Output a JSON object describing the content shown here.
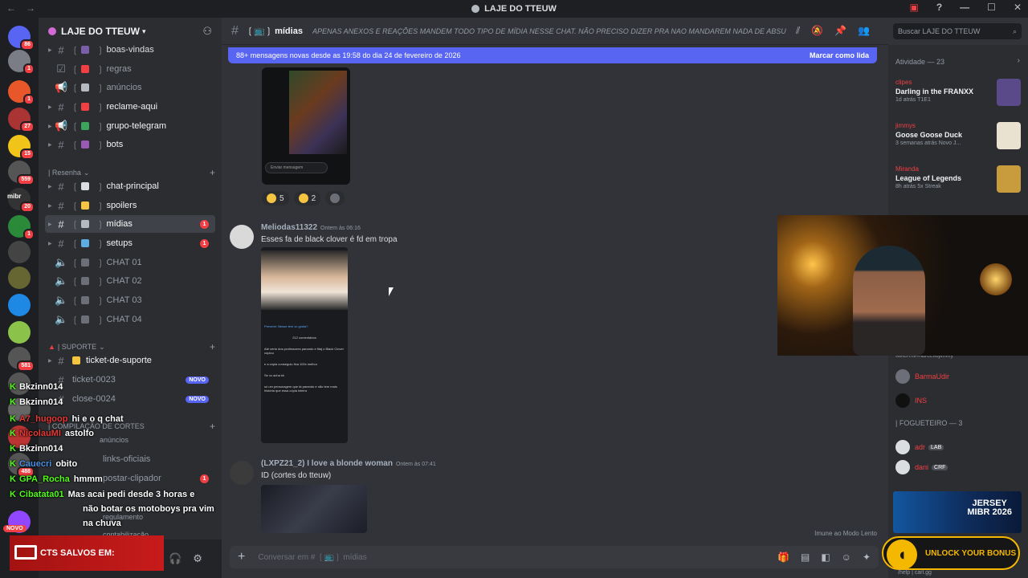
{
  "window": {
    "title": "LAJE DO TTEUW"
  },
  "guild": {
    "name": "LAJE DO TTEUW"
  },
  "servers": [
    {
      "badge": "86",
      "color": "#5865f2"
    },
    {
      "badge": "1",
      "color": "#7a7d85"
    },
    {
      "badge": "1",
      "color": "#e8572a"
    },
    {
      "badge": "27",
      "color": "#a33"
    },
    {
      "badge": "15",
      "color": "#f0c419"
    },
    {
      "badge": "559",
      "color": "#555"
    },
    {
      "badge": "20",
      "color": "#333"
    },
    {
      "badge": "1",
      "color": "#2a8a3a"
    },
    {
      "badge": "",
      "color": "#444"
    },
    {
      "badge": "",
      "color": "#663"
    },
    {
      "badge": "",
      "color": "#1e88e5"
    },
    {
      "badge": "",
      "color": "#8bc34a"
    },
    {
      "badge": "581",
      "color": "#555"
    },
    {
      "badge": "",
      "color": "#555"
    },
    {
      "badge": "",
      "color": "#666"
    },
    {
      "badge": "",
      "color": "#b33"
    },
    {
      "badge": "488",
      "color": "#555"
    },
    {
      "badge": "",
      "color": "#9146ff"
    }
  ],
  "rail_labels": {
    "mibr": "mibr",
    "novo": "NOVO"
  },
  "channels": {
    "boas_vindas": "boas-vindas",
    "regras": "regras",
    "anuncios": "anúncios",
    "reclame_aqui": "reclame-aqui",
    "grupo_telegram": "grupo-telegram",
    "bots": "bots",
    "cat_resenha": "| Resenha",
    "chat_principal": "chat-principal",
    "spoilers": "spoilers",
    "midias": "mídias",
    "midias_badge": "1",
    "setups": "setups",
    "setups_badge": "1",
    "chat01": "CHAT 01",
    "chat02": "CHAT 02",
    "chat03": "CHAT 03",
    "chat04": "CHAT 04",
    "cat_suporte": "| SUPORTE",
    "ticket_suporte": "ticket-de-suporte",
    "ticket_0023": "ticket-0023",
    "ticket_0024": "close-0024",
    "novo": "NOVO",
    "cat_cortes": "| COMPILAÇÃO DE CORTES",
    "cortes_anuncios": "anúncios",
    "links_oficiais": "links-oficiais",
    "postagem": "postar-clipador",
    "regulamento": "regulamento",
    "contabilizacao": "contabilização"
  },
  "overlay_chat": [
    {
      "name": "Bkzinn014",
      "color": "",
      "msg": ""
    },
    {
      "name": "Bkzinn014",
      "color": "",
      "msg": ""
    },
    {
      "name": "A7_hugoop",
      "color": "red",
      "msg": "hi e o q chat"
    },
    {
      "name": "NicolauMI",
      "color": "red",
      "msg": "astolfo"
    },
    {
      "name": "Bkzinn014",
      "color": "",
      "msg": ""
    },
    {
      "name": "Cauecri",
      "color": "blue",
      "msg": "obito"
    },
    {
      "name": "GPA_Rocha",
      "color": "green",
      "msg": "hmmm"
    },
    {
      "name": "Cibatata01",
      "color": "green",
      "msg": "Mas acai pedi desde 3 horas e"
    },
    {
      "name": "",
      "color": "",
      "msg": "não botar os motoboys pra vim"
    },
    {
      "name": "",
      "color": "",
      "msg": "na chuva"
    }
  ],
  "user_banner": "CTS SALVOS EM:",
  "header": {
    "channel": "mídias",
    "topic": "APENAS ANEXOS E REAÇÕES MANDEM TODO TIPO DE MÍDIA NESSE CHAT. NÃO PRECISO DIZER PRA NAO MANDAREM NADA DE ABSURDO NÉ? ...",
    "search_placeholder": "Buscar LAJE DO TTEUW"
  },
  "newbar": {
    "text": "88+ mensagens novas desde as 19:58 do dia 24 de fevereiro de 2026",
    "action": "Marcar como lida"
  },
  "messages": {
    "img_input": "Enviar mensagem",
    "reactions": [
      {
        "count": "5"
      },
      {
        "count": "2"
      }
    ],
    "m1": {
      "author": "Meliodas11322",
      "time": "Ontem às 06:16",
      "text": "Esses fa de black clover é fd em tropa",
      "author_color": "#a6b0bd"
    },
    "phone": {
      "header": "Prevenir: Nesse tem vc gosta?",
      "count": "212 comentários",
      "c1": "Até certo dos professores parando e fitaj o Black Clover copiou",
      "c2": "e a cópia conseguiu fica 100x melhor",
      "c3": "Se vc acha kk",
      "c4": "só um personagem que tá parando e não tem mais história que essa cópia inteira"
    },
    "m2": {
      "author": "(LXPZ21_2) I love a blonde woman",
      "time": "Ontem às 07:41",
      "text": "ID (cortes do tteuw)",
      "author_color": "#a6b0bd"
    },
    "slow_mode": "Imune ao Modo Lento",
    "composer": "Conversar em # ❲📺❳ mídias"
  },
  "activity": {
    "title": "Atividade — 23",
    "items": [
      {
        "user": "clipes",
        "title": "Darling in the FRANXX",
        "sub": "1d atrás  T1E1",
        "thumb": "#5b4a8a"
      },
      {
        "user": "jimmys",
        "title": "Goose Goose Duck",
        "sub": "3 semanas atrás  Novo J...",
        "thumb": "#e9e2d0"
      },
      {
        "user": "Miranda",
        "title": "League of Legends",
        "sub": "8h atrás  5x Streak",
        "thumb": "#c89b3c"
      }
    ]
  },
  "right_lower": {
    "twitch": "twitch.tv/marcellojimmy",
    "u1": "BarmaUdir",
    "u2": "INS",
    "section": "| FOGUETEIRO — 3",
    "u3": "adr",
    "u3_tag": "LAB",
    "u4": "dani",
    "u4_tag": "CRF",
    "ad_line1": "JERSEY",
    "ad_line2": "MIBR 2026",
    "unlock": "UNLOCK YOUR BONUS",
    "help": "/help | carl.gg"
  }
}
